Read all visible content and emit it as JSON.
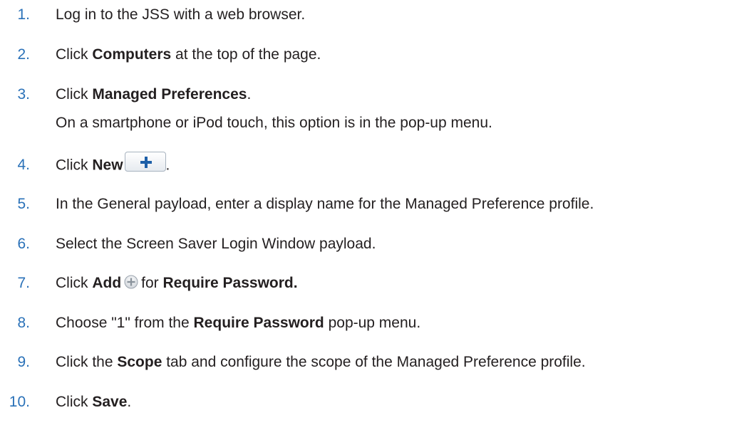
{
  "steps": [
    {
      "number": "1.",
      "parts": [
        "Log in to the JSS with a web browser."
      ]
    },
    {
      "number": "2.",
      "parts": [
        "Click ",
        "Computers",
        " at the top of the page."
      ]
    },
    {
      "number": "3.",
      "parts": [
        "Click ",
        "Managed Preferences",
        "."
      ],
      "note": "On a smartphone or iPod touch, this option is in the pop-up menu."
    },
    {
      "number": "4.",
      "parts": [
        "Click ",
        "New",
        "."
      ]
    },
    {
      "number": "5.",
      "parts": [
        "In the General payload, enter a display name for the Managed Preference profile."
      ]
    },
    {
      "number": "6.",
      "parts": [
        "Select the Screen Saver Login Window payload."
      ]
    },
    {
      "number": "7.",
      "parts": [
        "Click ",
        "Add",
        "for ",
        "Require Password."
      ]
    },
    {
      "number": "8.",
      "parts": [
        "Choose \"1\" from the ",
        "Require Password",
        " pop-up menu."
      ]
    },
    {
      "number": "9.",
      "parts": [
        "Click the ",
        "Scope",
        " tab and configure the scope of the Managed Preference profile."
      ]
    },
    {
      "number": "10.",
      "parts": [
        "Click ",
        "Save",
        "."
      ]
    }
  ],
  "icons": {
    "new_button": "plus-icon",
    "add_button": "plus-circle-icon"
  },
  "colors": {
    "step_number": "#2a71b8",
    "text": "#231f20",
    "plus": "#1d5fa8"
  }
}
